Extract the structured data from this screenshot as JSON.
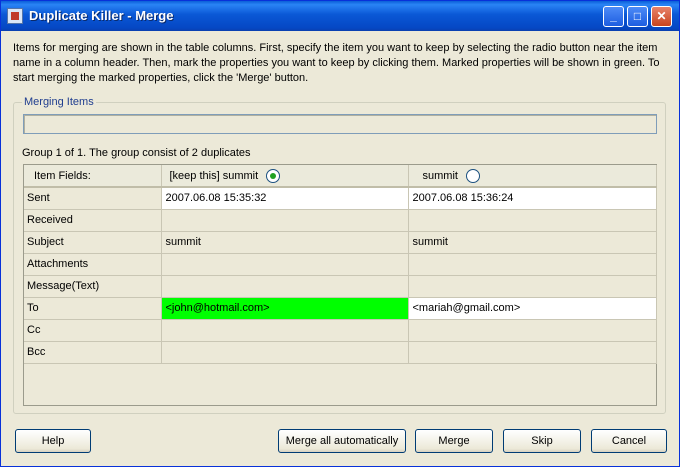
{
  "window": {
    "title": "Duplicate Killer - Merge",
    "minimize_label": "_",
    "maximize_label": "□",
    "close_label": "✕"
  },
  "intro_text": "Items for merging are shown in the table columns. First, specify the item you want to keep by selecting the radio button near the item name in a column header. Then, mark the properties you want to keep by clicking them. Marked properties will be shown in green. To start merging the marked properties, click the 'Merge' button.",
  "merging_items": {
    "legend": "Merging Items",
    "group_info": "Group 1 of 1. The group consist of 2 duplicates"
  },
  "grid": {
    "header_fields": "Item Fields:",
    "columns": [
      {
        "label": "[keep this] summit",
        "selected": true
      },
      {
        "label": "summit",
        "selected": false
      }
    ],
    "rows": [
      {
        "field": "Sent",
        "values": [
          "2007.06.08 15:35:32",
          "2007.06.08 15:36:24"
        ]
      },
      {
        "field": "Received",
        "values": [
          "",
          ""
        ]
      },
      {
        "field": "Subject",
        "values": [
          "summit",
          "summit"
        ]
      },
      {
        "field": "Attachments",
        "values": [
          "",
          ""
        ]
      },
      {
        "field": "Message(Text)",
        "values": [
          "",
          ""
        ]
      },
      {
        "field": "To",
        "values": [
          "<john@hotmail.com>",
          "<mariah@gmail.com>"
        ]
      },
      {
        "field": "Cc",
        "values": [
          "",
          ""
        ]
      },
      {
        "field": "Bcc",
        "values": [
          "",
          ""
        ]
      }
    ],
    "marked_color": "#00ff00"
  },
  "buttons": {
    "help": "Help",
    "merge_all": "Merge all automatically",
    "merge": "Merge",
    "skip": "Skip",
    "cancel": "Cancel"
  }
}
